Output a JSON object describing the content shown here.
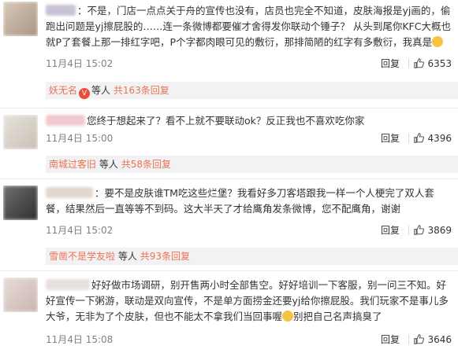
{
  "comments": [
    {
      "text": "：不是，门店一点点关于舟的宣传也没有，店员也完全不知道，皮肤海报是yj画的，偷跑出问题是yj擦屁股的……连一条微博都要催才舍得发你联动个锤子？ 从头到尾你KFC大概也就P了套餐上那一排红字吧，P个字都肉眼可见的敷衍，那排简陋的红字有多敷衍，我真是",
      "time": "11月4日 15:02",
      "reply_label": "回复",
      "likes": "6353",
      "sub": {
        "user": "妖无名",
        "mid": "等人",
        "count": "共163条回复"
      }
    },
    {
      "text": "您终于想起来了？看不上就不要联动ok？反正我也不喜欢吃你家",
      "time": "11月4日 15:00",
      "reply_label": "回复",
      "likes": "4396",
      "sub": {
        "user": "南城过客旧",
        "mid": "等人",
        "count": "共58条回复"
      }
    },
    {
      "text": "：要不是皮肤谁TM吃这些烂堡？我看好多刀客塔跟我一样一个人梗完了双人套餐，结果然后一直等等不到码。这大半天了才给鹰角发条微博，您不配鹰角，谢谢",
      "time": "11月4日 15:02",
      "reply_label": "回复",
      "likes": "3869",
      "sub": {
        "user": "雪凿不是学友啦",
        "mid": "等人",
        "count": "共93条回复"
      }
    },
    {
      "text": "好好做市场调研，别开售两小时全部售空。好好培训一下客服，别一问三不知。好好宣传一下粥游，联动是双向宣传，不是单方面捞金还要yj给你擦屁股。我们玩家不是事儿多大爷，无非为了个皮肤，但也不能太不拿我们当回事喔",
      "text_tail": "别把自己名声搞臭了",
      "time": "11月4日 15:08",
      "reply_label": "回复",
      "likes": "3646"
    }
  ],
  "colors": {
    "accent": "#eb7350",
    "sub_bg": "#f2f2f5",
    "meta": "#808080"
  },
  "icons": {
    "like": "thumbs-up-icon",
    "emoji": "smile-emoji-icon"
  }
}
